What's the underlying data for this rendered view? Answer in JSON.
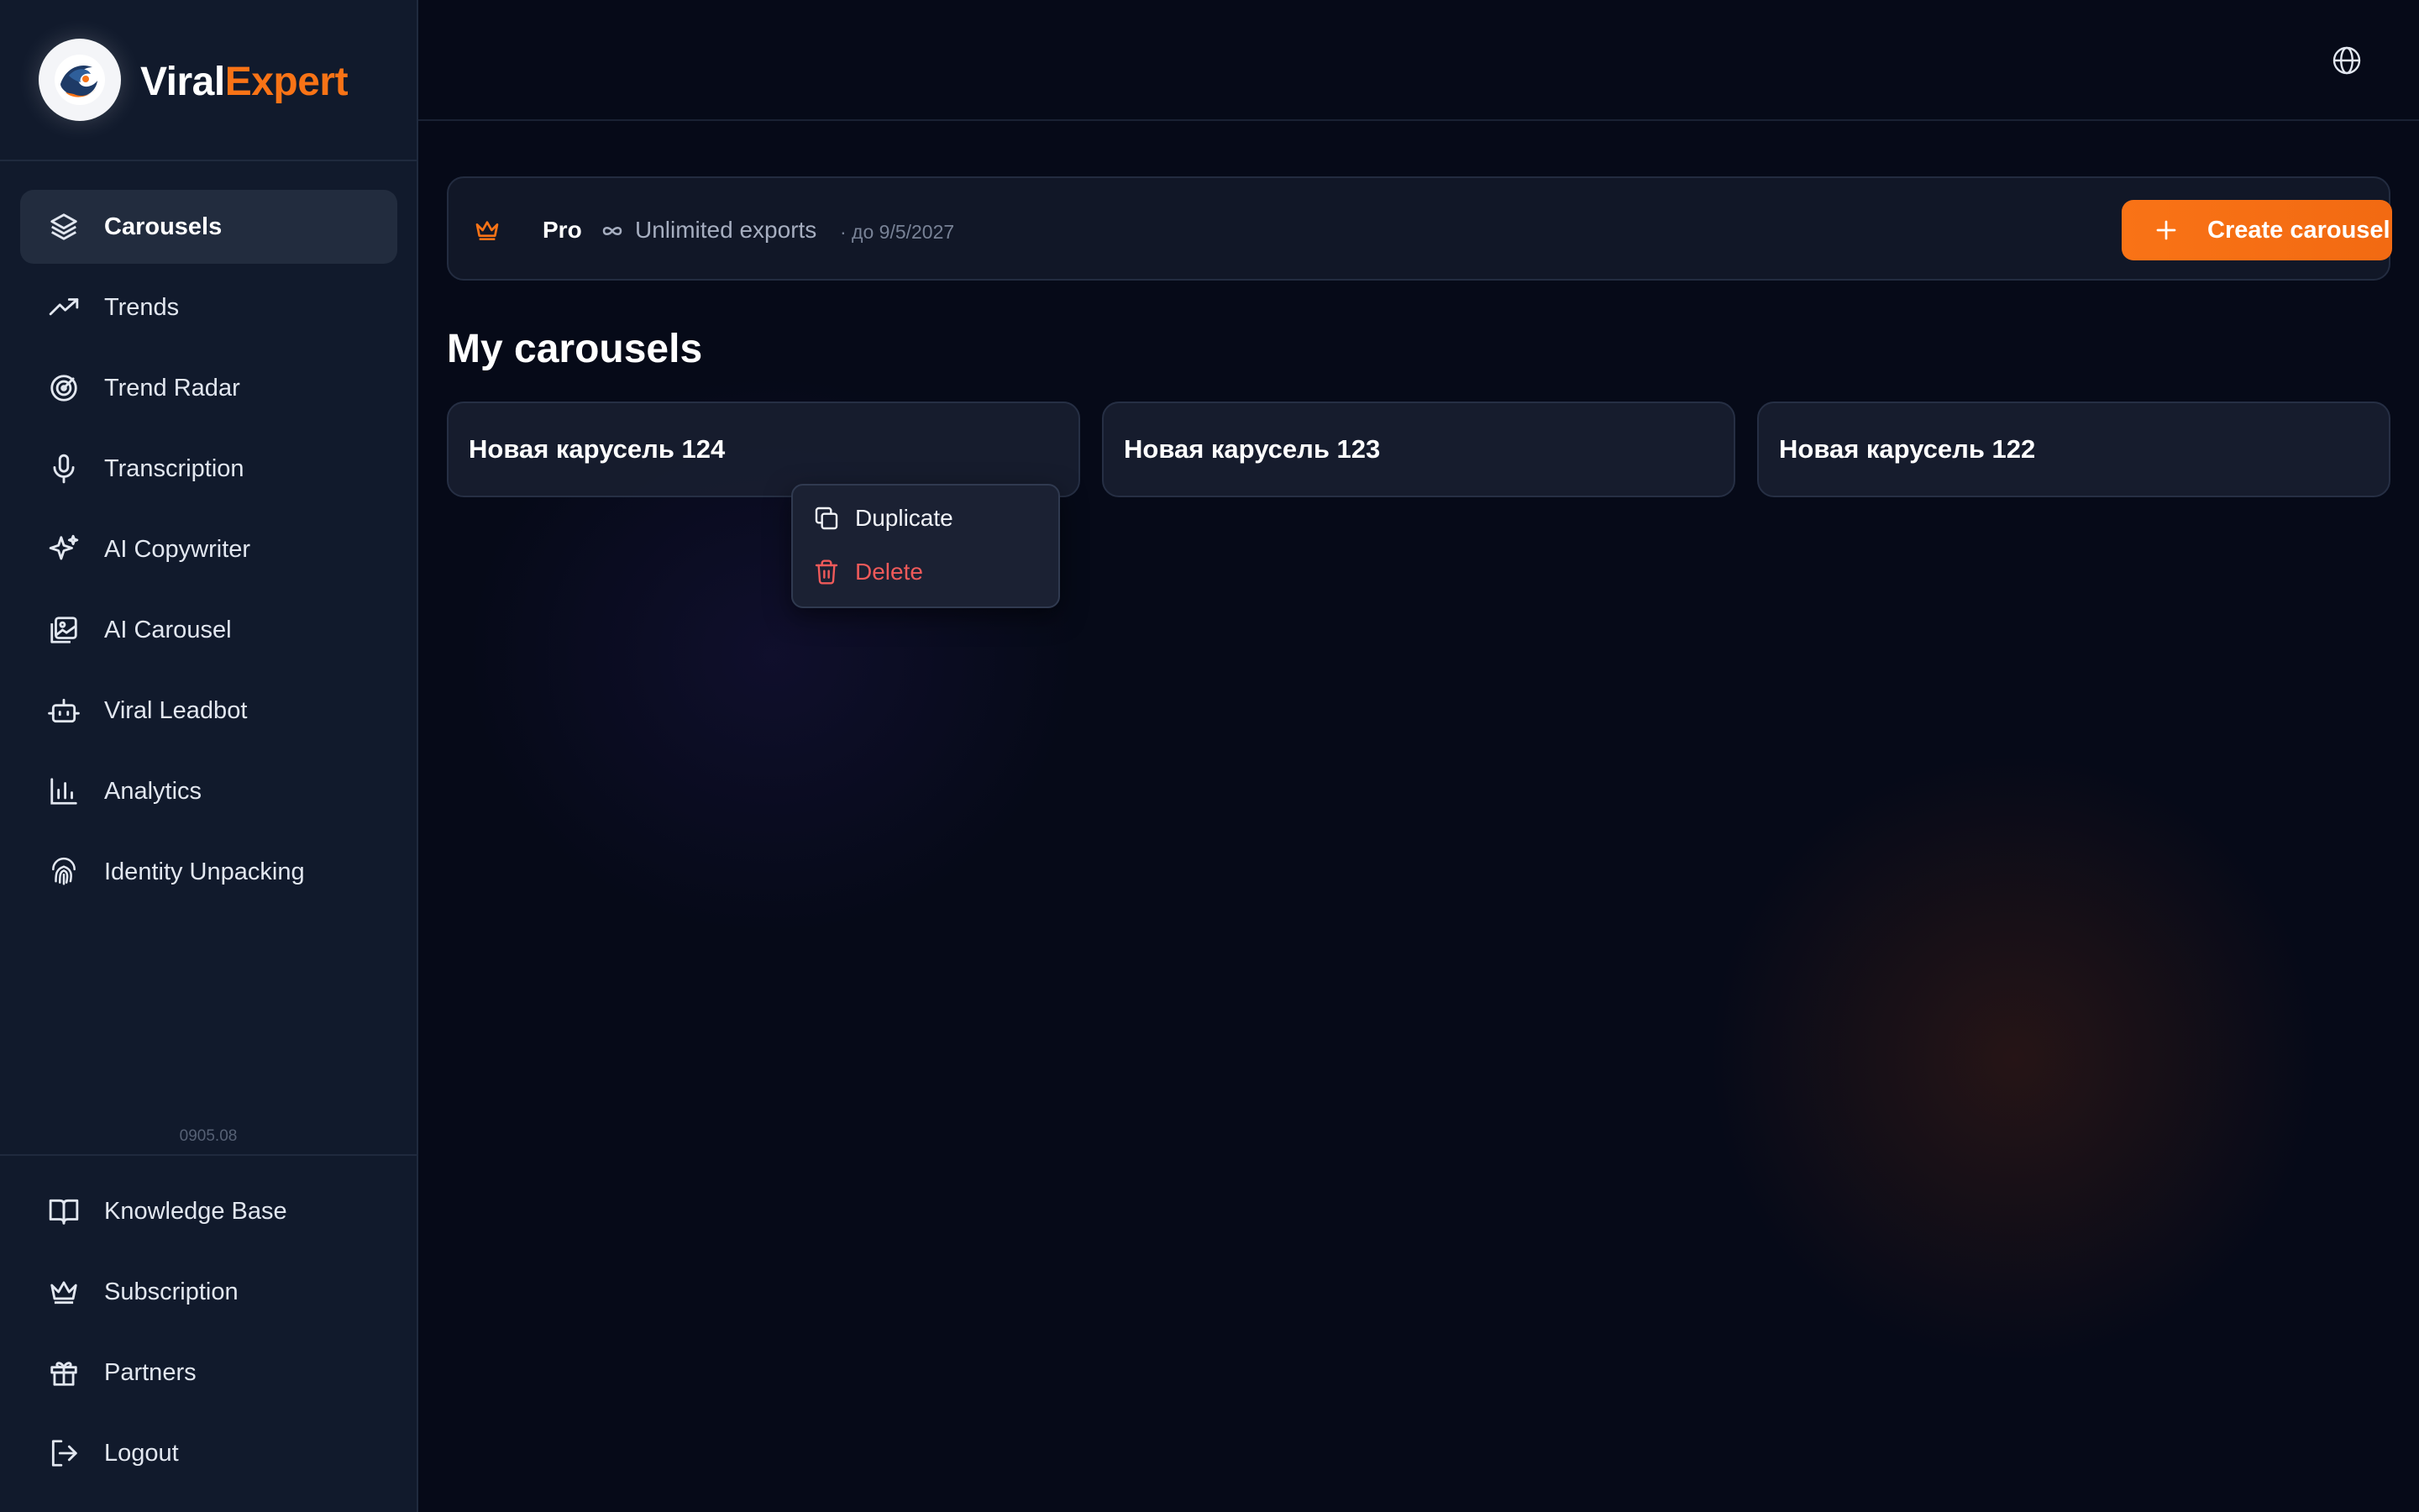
{
  "brand": {
    "part1": "Viral",
    "part2": "Expert"
  },
  "nav": [
    {
      "label": "Carousels",
      "icon": "layers-icon",
      "active": true
    },
    {
      "label": "Trends",
      "icon": "trend-up-icon"
    },
    {
      "label": "Trend Radar",
      "icon": "radar-icon"
    },
    {
      "label": "Transcription",
      "icon": "microphone-icon"
    },
    {
      "label": "AI Copywriter",
      "icon": "sparkles-icon"
    },
    {
      "label": "AI Carousel",
      "icon": "images-icon"
    },
    {
      "label": "Viral Leadbot",
      "icon": "bot-icon"
    },
    {
      "label": "Analytics",
      "icon": "bar-chart-icon"
    },
    {
      "label": "Identity Unpacking",
      "icon": "fingerprint-icon"
    }
  ],
  "version": "0905.08",
  "nav_bottom": [
    {
      "label": "Knowledge Base",
      "icon": "book-icon"
    },
    {
      "label": "Subscription",
      "icon": "crown-icon"
    },
    {
      "label": "Partners",
      "icon": "gift-icon"
    },
    {
      "label": "Logout",
      "icon": "logout-icon"
    }
  ],
  "plan": {
    "name": "Pro",
    "exports": "Unlimited exports",
    "until": "· до 9/5/2027",
    "create_label": "Create carousel"
  },
  "section_title": "My carousels",
  "carousels": [
    {
      "title": "Новая карусель 124"
    },
    {
      "title": "Новая карусель 123"
    },
    {
      "title": "Новая карусель 122"
    }
  ],
  "context_menu": {
    "duplicate": "Duplicate",
    "delete": "Delete"
  },
  "colors": {
    "accent": "#f97316",
    "danger": "#ef5a5a",
    "sidebar_bg": "#111a2c",
    "main_bg": "#060a18"
  }
}
